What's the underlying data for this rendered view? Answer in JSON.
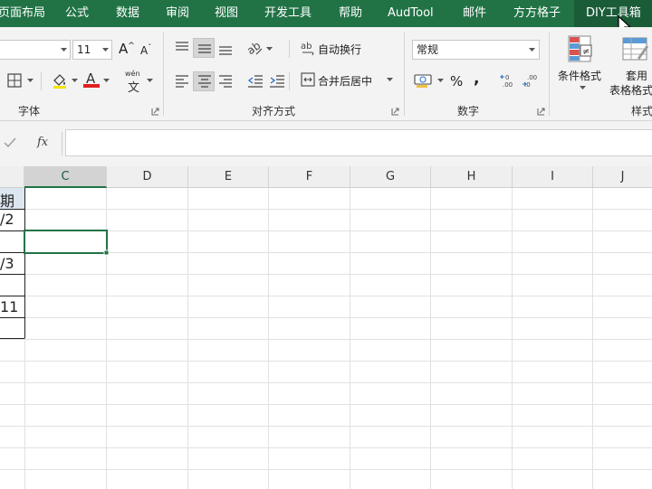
{
  "menu": {
    "tabs": [
      {
        "label": "页面布局",
        "active": false
      },
      {
        "label": "公式",
        "active": false
      },
      {
        "label": "数据",
        "active": false
      },
      {
        "label": "审阅",
        "active": false
      },
      {
        "label": "视图",
        "active": false
      },
      {
        "label": "开发工具",
        "active": false
      },
      {
        "label": "帮助",
        "active": false
      },
      {
        "label": "AudTool",
        "active": false
      },
      {
        "label": "邮件",
        "active": false
      },
      {
        "label": "方方格子",
        "active": false
      },
      {
        "label": "DIY工具箱",
        "active": true
      }
    ]
  },
  "ribbon": {
    "font": {
      "group_label": "字体",
      "font_size": "11",
      "grow_label": "A",
      "shrink_label": "A",
      "phonetic_top": "wén",
      "phonetic_bottom": "文",
      "font_color": "#e02020"
    },
    "alignment": {
      "group_label": "对齐方式",
      "wrap_text": "自动换行",
      "merge_center": "合并后居中"
    },
    "number": {
      "group_label": "数字",
      "format": "常规",
      "percent": "%",
      "comma": ","
    },
    "styles": {
      "group_label": "样式",
      "conditional_format": "条件格式",
      "format_table_line1": "套用",
      "format_table_line2": "表格格式"
    }
  },
  "formula_bar": {
    "fx_label": "fx",
    "value": ""
  },
  "sheet": {
    "columns": [
      "C",
      "D",
      "E",
      "F",
      "G",
      "H",
      "I",
      "J"
    ],
    "selected_column": "C",
    "selected_cell": "C3",
    "partial_cells": [
      "期",
      "/2",
      "",
      "/3",
      "",
      "11",
      ""
    ],
    "header_fill": "#dce6f1",
    "accent": "#217346"
  }
}
